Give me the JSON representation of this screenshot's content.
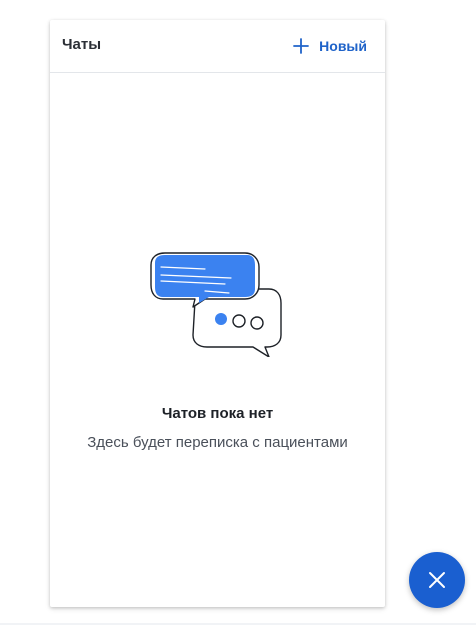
{
  "header": {
    "title": "Чаты",
    "new_button_label": "Новый",
    "new_button_icon": "plus-icon"
  },
  "empty_state": {
    "illustration": "chat-bubbles-illustration",
    "title": "Чатов пока нет",
    "subtitle": "Здесь будет переписка с пациентами"
  },
  "fab": {
    "icon": "close-icon"
  },
  "colors": {
    "accent": "#1a5fd0",
    "bubble_fill": "#3b82f0",
    "text_primary": "#1d2127",
    "text_secondary": "#4a505a"
  }
}
